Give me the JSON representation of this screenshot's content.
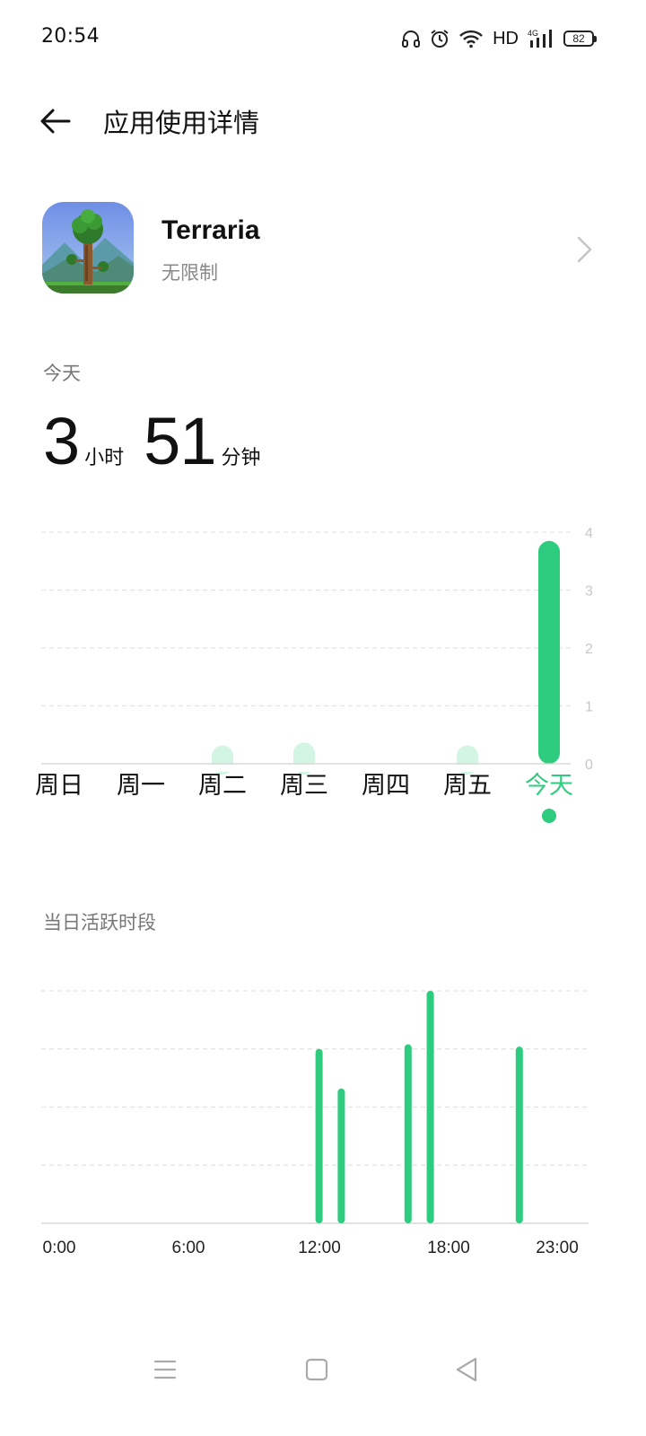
{
  "status_bar": {
    "time": "20:54",
    "network": "HD",
    "signal_type": "4G",
    "battery": "82",
    "icons": [
      "headphones-icon",
      "alarm-icon",
      "wifi-icon",
      "signal-icon",
      "battery-icon"
    ]
  },
  "header": {
    "title": "应用使用详情",
    "back_icon": "arrow-left-icon"
  },
  "app": {
    "name": "Terraria",
    "limit_status": "无限制",
    "icon": "terraria-app-icon"
  },
  "today": {
    "label": "今天",
    "hours": "3",
    "hours_unit": "小时",
    "minutes": "51",
    "minutes_unit": "分钟"
  },
  "active_period": {
    "label": "当日活跃时段"
  },
  "colors": {
    "accent": "#2ecc7f",
    "accent_light": "#d3f5e3",
    "grid": "#e3e3e3"
  },
  "chart_data": [
    {
      "type": "bar",
      "categories": [
        "周日",
        "周一",
        "周二",
        "周三",
        "周四",
        "周五",
        "今天"
      ],
      "values": [
        0,
        0,
        0.1,
        0.15,
        0,
        0.1,
        3.85
      ],
      "yticks": [
        "0",
        "1",
        "2",
        "3",
        "4"
      ],
      "ylim": [
        0,
        4
      ],
      "selected_category": "今天",
      "grid": true
    },
    {
      "type": "bar",
      "xticks": [
        "0:00",
        "6:00",
        "12:00",
        "18:00",
        "23:00"
      ],
      "x": [
        12,
        13,
        16,
        17,
        21
      ],
      "values": [
        0.75,
        0.58,
        0.77,
        1.0,
        0.76
      ],
      "ylim": [
        0,
        1
      ],
      "grid": true
    }
  ],
  "nav_bar": {
    "icons": [
      "menu-icon",
      "home-square-icon",
      "back-triangle-icon"
    ]
  }
}
